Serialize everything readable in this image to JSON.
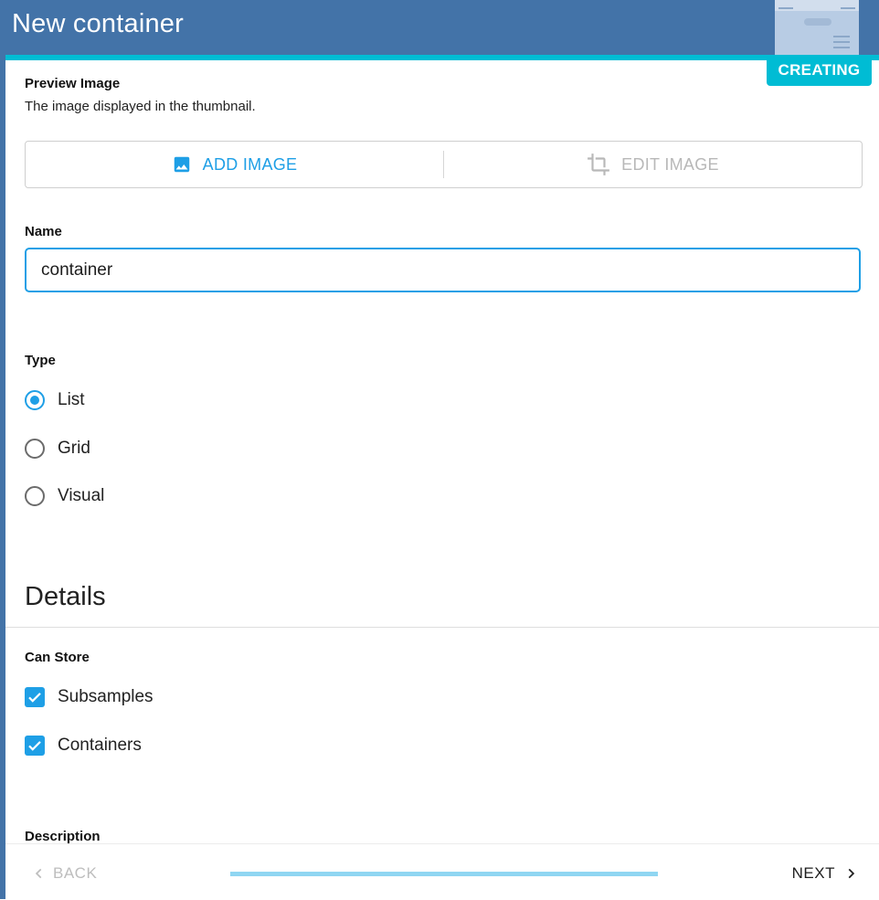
{
  "header": {
    "title": "New container",
    "status_badge": "CREATING"
  },
  "preview_image": {
    "label": "Preview Image",
    "helper": "The image displayed in the thumbnail.",
    "add_label": "ADD IMAGE",
    "edit_label": "EDIT IMAGE"
  },
  "name_field": {
    "label": "Name",
    "value": "container"
  },
  "type_field": {
    "label": "Type",
    "options": [
      {
        "label": "List",
        "checked": true
      },
      {
        "label": "Grid",
        "checked": false
      },
      {
        "label": "Visual",
        "checked": false
      }
    ]
  },
  "details": {
    "title": "Details",
    "can_store_label": "Can Store",
    "can_store_options": [
      {
        "label": "Subsamples",
        "checked": true
      },
      {
        "label": "Containers",
        "checked": true
      }
    ],
    "description_label": "Description"
  },
  "footer": {
    "back_label": "BACK",
    "next_label": "NEXT",
    "progress": 1.0
  },
  "colors": {
    "header": "#4373a8",
    "accent": "#00bcd4",
    "primary": "#1e9fe6"
  }
}
